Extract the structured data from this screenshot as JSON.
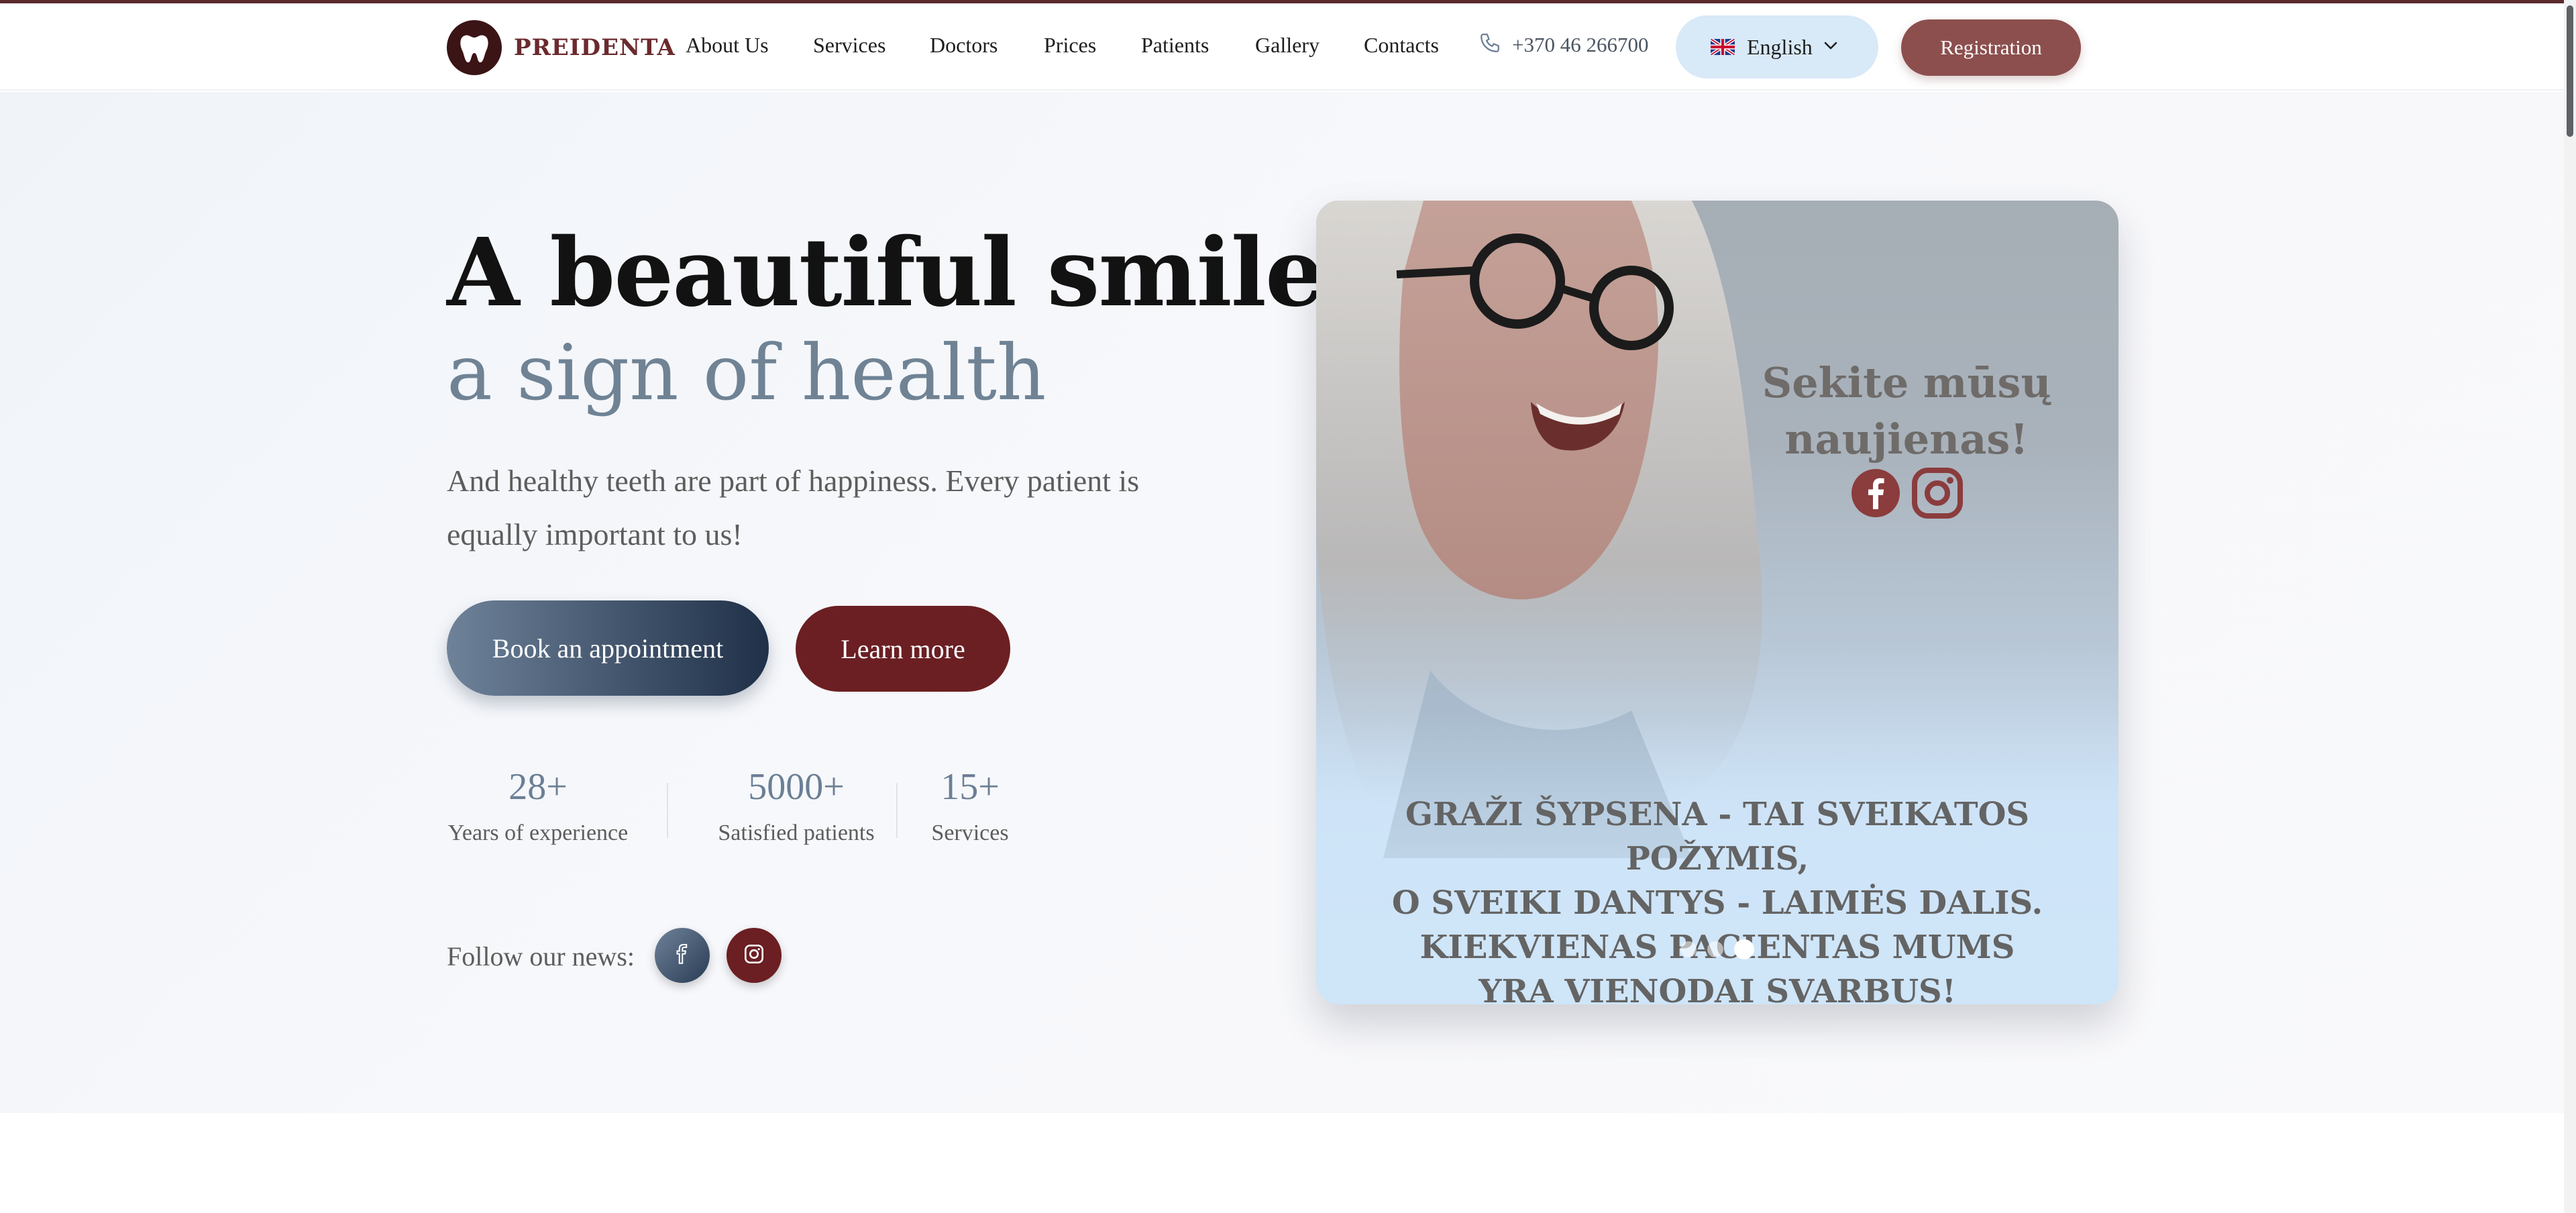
{
  "brand": {
    "name": "PREIDENTA",
    "color": "#6b2a2e"
  },
  "nav": {
    "items": [
      "About Us",
      "Services",
      "Doctors",
      "Prices",
      "Patients",
      "Gallery",
      "Contacts"
    ],
    "phone": "+370 46 266700",
    "language": "English",
    "register_label": "Registration"
  },
  "hero": {
    "title_line1": "A beautiful smile is",
    "title_line2": "a sign of health",
    "lead": "And healthy teeth are part of happiness. Every patient is equally important to us!",
    "book_label": "Book an appointment",
    "learn_label": "Learn more",
    "stats": [
      {
        "value": "28+",
        "label": "Years of experience"
      },
      {
        "value": "5000+",
        "label": "Satisfied patients"
      },
      {
        "value": "15+",
        "label": "Services"
      }
    ],
    "follow_label": "Follow our news:"
  },
  "promo": {
    "follow_title": "Sekite mūsų naujienas!",
    "caption": [
      "GRAŽI ŠYPSENA - TAI SVEIKATOS POŽYMIS,",
      "O SVEIKI DANTYS - LAIMĖS DALIS.",
      "KIEKVIENAS PACIENTAS MUMS",
      "YRA VIENODAI SVARBUS!"
    ],
    "slides_total": 3,
    "slide_active": 3
  },
  "icons": {
    "logo": "tooth-icon",
    "phone": "phone-icon",
    "flag": "uk-flag-icon",
    "chevron": "chevron-down-icon",
    "facebook": "facebook-icon",
    "instagram": "instagram-icon"
  },
  "colors": {
    "accent_dark_red": "#6b1f23",
    "register_red": "#8c4f4e",
    "slate_blue": "#6f8395",
    "navy": "#1f3048",
    "lang_pill": "#d8e9f8"
  }
}
